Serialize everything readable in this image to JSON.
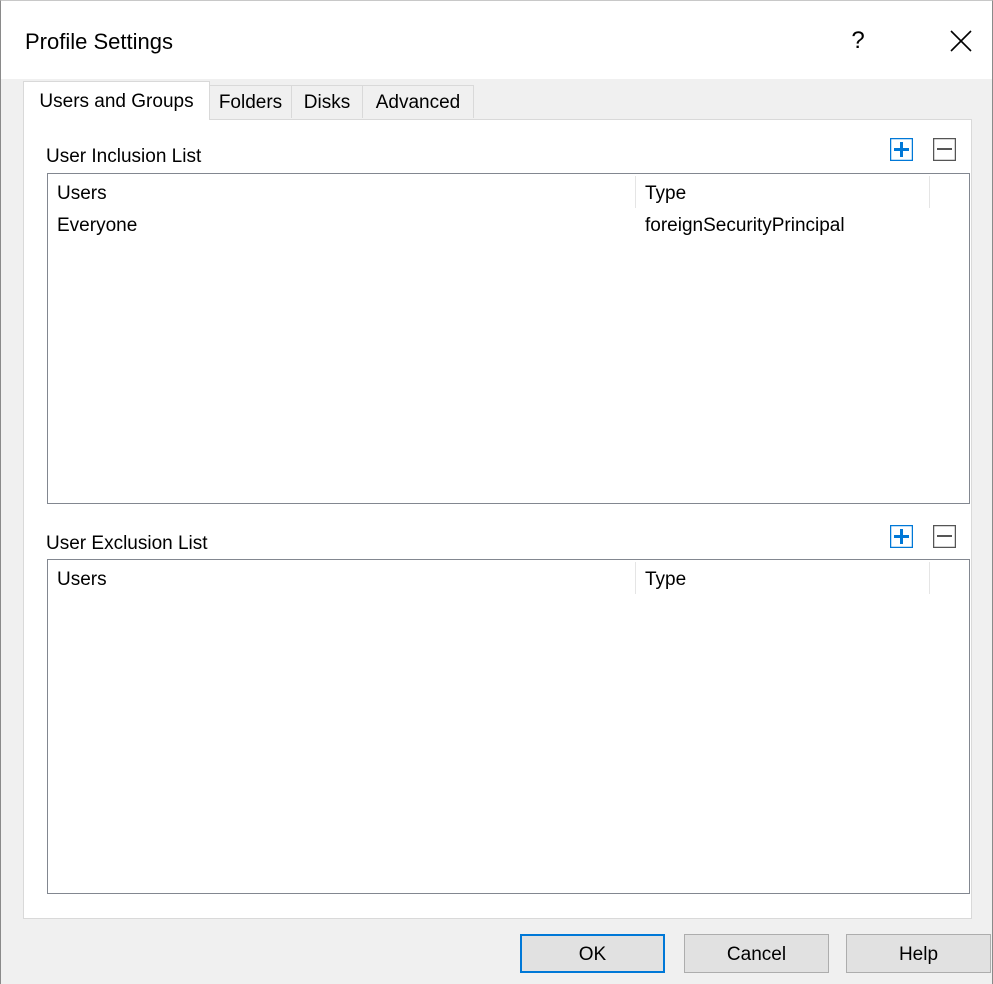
{
  "window": {
    "title": "Profile Settings",
    "help_glyph": "?",
    "close_icon": "close-icon"
  },
  "tabs": [
    {
      "label": "Users and Groups",
      "active": true
    },
    {
      "label": "Folders",
      "active": false
    },
    {
      "label": "Disks",
      "active": false
    },
    {
      "label": "Advanced",
      "active": false
    }
  ],
  "inclusion": {
    "label": "User Inclusion List",
    "add_icon": "plus-icon",
    "remove_icon": "minus-icon",
    "columns": [
      "Users",
      "Type"
    ],
    "rows": [
      {
        "user": "Everyone",
        "type": "foreignSecurityPrincipal"
      }
    ]
  },
  "exclusion": {
    "label": "User Exclusion List",
    "add_icon": "plus-icon",
    "remove_icon": "minus-icon",
    "columns": [
      "Users",
      "Type"
    ],
    "rows": []
  },
  "buttons": {
    "ok": "OK",
    "cancel": "Cancel",
    "help": "Help"
  },
  "colors": {
    "accent": "#0078d7",
    "window_bg": "#f0f0f0",
    "panel_bg": "#ffffff"
  }
}
